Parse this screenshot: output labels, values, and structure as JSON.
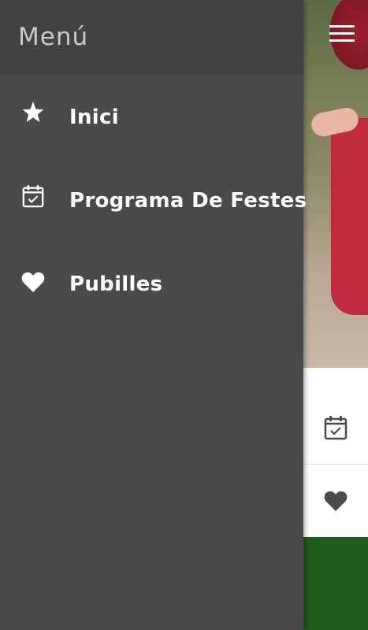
{
  "drawer": {
    "title": "Menú",
    "items": [
      {
        "label": "Inici",
        "icon": "star-icon"
      },
      {
        "label": "Programa De Festes",
        "icon": "calendar-check-icon"
      },
      {
        "label": "Pubilles",
        "icon": "heart-icon"
      }
    ]
  },
  "background": {
    "menu_icon": "hamburger-icon",
    "rows": [
      {
        "icon": "calendar-check-icon"
      },
      {
        "icon": "heart-icon"
      }
    ]
  },
  "colors": {
    "drawer_bg": "#4a4a4a",
    "drawer_header_bg": "#424242",
    "title_text": "#c9c9c9",
    "item_text": "#ffffff",
    "footer_green": "#1f5b1a",
    "bg_icon": "#4a4a4a"
  }
}
